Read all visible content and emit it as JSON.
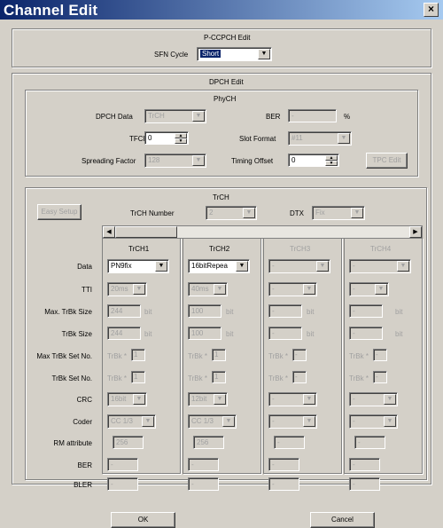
{
  "window": {
    "title": "Channel Edit",
    "close_glyph": "×"
  },
  "pccpch": {
    "group_title": "P-CCPCH Edit",
    "sfn_cycle_label": "SFN Cycle",
    "sfn_cycle_value": "Short"
  },
  "dpch": {
    "group_title": "DPCH Edit",
    "phych_title": "PhyCH",
    "dpch_data_label": "DPCH Data",
    "dpch_data_value": "TrCH",
    "ber_label": "BER",
    "ber_value": "-",
    "ber_unit": "%",
    "tfci_label": "TFCI",
    "tfci_value": "0",
    "slot_format_label": "Slot Format",
    "slot_format_value": "#11",
    "spreading_factor_label": "Spreading Factor",
    "spreading_factor_value": "128",
    "timing_offset_label": "Timing Offset",
    "timing_offset_value": "0",
    "tpc_edit_label": "TPC Edit"
  },
  "trch": {
    "group_title": "TrCH",
    "easy_setup_label": "Easy Setup",
    "trch_number_label": "TrCH Number",
    "trch_number_value": "2",
    "dtx_label": "DTX",
    "dtx_value": "Fix",
    "row_labels": [
      "Data",
      "TTI",
      "Max. TrBk Size",
      "TrBk Size",
      "Max TrBk Set No.",
      "TrBk Set No.",
      "CRC",
      "Coder",
      "RM attribute",
      "BER",
      "BLER"
    ],
    "columns": [
      {
        "header": "TrCH1",
        "data": "PN9fix",
        "tti": "20ms",
        "max_trbk_size": "244",
        "trbk_size": "244",
        "unit_bit": "bit",
        "set_prefix": "TrBk *",
        "max_set_no": "1",
        "set_no": "1",
        "crc": "16bit",
        "coder": "CC 1/3",
        "rm": "256",
        "ber": "-",
        "bler": "-"
      },
      {
        "header": "TrCH2",
        "data": "16bitRepea",
        "tti": "40ms",
        "max_trbk_size": "100",
        "trbk_size": "100",
        "unit_bit": "bit",
        "set_prefix": "TrBk *",
        "max_set_no": "1",
        "set_no": "1",
        "crc": "12bit",
        "coder": "CC 1/3",
        "rm": "256",
        "ber": "-",
        "bler": "-"
      },
      {
        "header": "TrCH3",
        "data": "-",
        "tti": "-",
        "max_trbk_size": "-",
        "trbk_size": "-",
        "unit_bit": "bit",
        "set_prefix": "TrBk *",
        "max_set_no": "-",
        "set_no": "-",
        "crc": "-",
        "coder": "-",
        "rm": "-",
        "ber": "-",
        "bler": "-"
      },
      {
        "header": "TrCH4",
        "data": "-",
        "tti": "-",
        "max_trbk_size": "-",
        "trbk_size": "-",
        "unit_bit": "bit",
        "set_prefix": "TrBk *",
        "max_set_no": "-",
        "set_no": "-",
        "crc": "-",
        "coder": "-",
        "rm": "-",
        "ber": "-",
        "bler": "-"
      }
    ]
  },
  "footer": {
    "ok_label": "OK",
    "cancel_label": "Cancel"
  },
  "icons": {
    "arrow_down": "▼",
    "arrow_left": "◀",
    "arrow_right": "▶",
    "spin_up": "▲",
    "spin_down": "▼"
  }
}
